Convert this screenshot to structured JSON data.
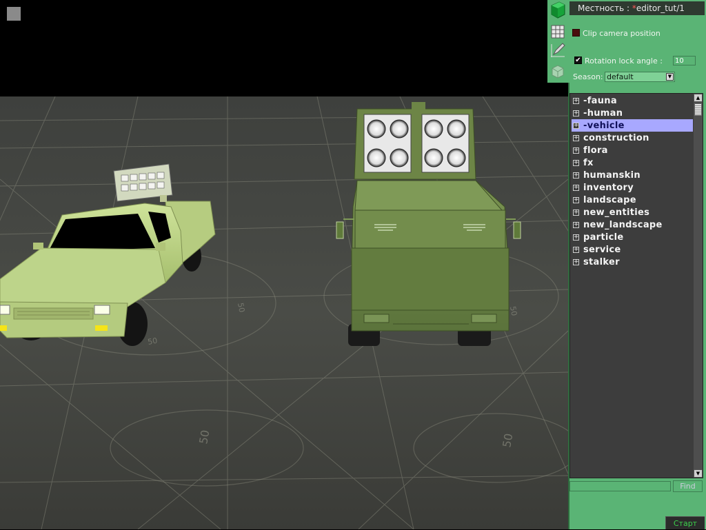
{
  "viewport": {
    "corner_button": "square-icon",
    "scene": {
      "floor_markings": [
        "50",
        "50",
        "50",
        "50",
        "50",
        "50"
      ],
      "vehicles": [
        "pickup-truck-with-rocket-launcher",
        "armored-truck-with-rocket-launcher"
      ]
    }
  },
  "toolbar": {
    "tools": [
      {
        "name": "object-tool",
        "icon": "green-cube-icon"
      },
      {
        "name": "grid-tool",
        "icon": "grid-icon"
      },
      {
        "name": "pencil-tool",
        "icon": "pencil-icon"
      },
      {
        "name": "transform-tool",
        "icon": "axis-cube-icon"
      }
    ]
  },
  "panel": {
    "title_prefix": "Местность",
    "title_separator": ":",
    "title_modified_marker": "*",
    "title_name": "editor_tut/1",
    "clip_camera": {
      "label": "Clip camera position",
      "checked": false
    },
    "rotation_lock": {
      "label": "Rotation lock angle :",
      "checked": true,
      "value": "10",
      "check_mark": "✔"
    },
    "season": {
      "label": "Season:",
      "value": "default",
      "arrow": "▼"
    },
    "tree": {
      "expander_symbol": "+",
      "items": [
        {
          "label": "-fauna",
          "selected": false
        },
        {
          "label": "-human",
          "selected": false
        },
        {
          "label": "-vehicle",
          "selected": true
        },
        {
          "label": "construction",
          "selected": false
        },
        {
          "label": "flora",
          "selected": false
        },
        {
          "label": "fx",
          "selected": false
        },
        {
          "label": "humanskin",
          "selected": false
        },
        {
          "label": "inventory",
          "selected": false
        },
        {
          "label": "landscape",
          "selected": false
        },
        {
          "label": "new_entities",
          "selected": false
        },
        {
          "label": "new_landscape",
          "selected": false
        },
        {
          "label": "particle",
          "selected": false
        },
        {
          "label": "service",
          "selected": false
        },
        {
          "label": "stalker",
          "selected": false
        }
      ],
      "scroll_up": "▲",
      "scroll_down": "▼"
    },
    "find_value": "",
    "find_label": "Find",
    "start_label": "Старт"
  },
  "colors": {
    "panel_green": "#5ab475",
    "selection": "#a8a8ff",
    "tree_bg": "#3d3d3d",
    "start_text": "#3bd14c",
    "title_modified": "#ff5a5a"
  }
}
